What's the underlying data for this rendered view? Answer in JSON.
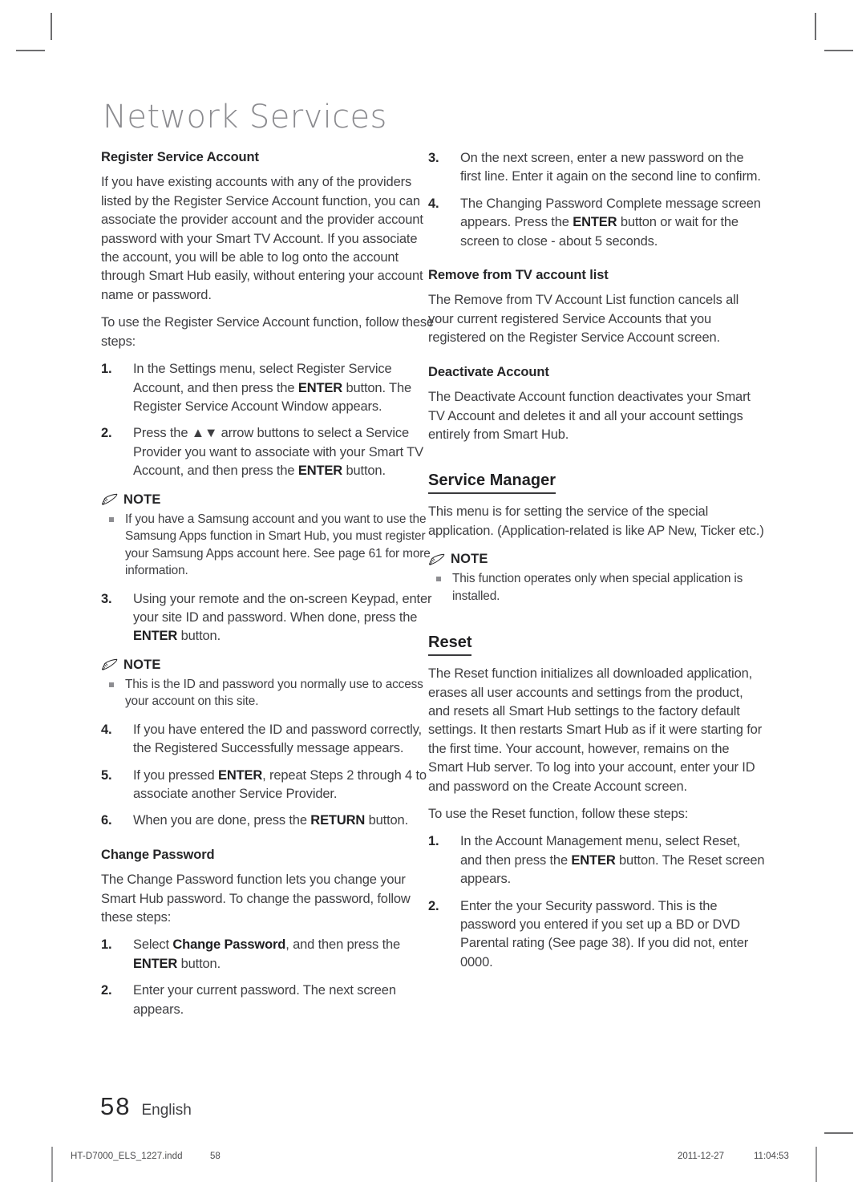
{
  "chapter": {
    "title": "Network Services"
  },
  "left_column": {
    "section1": {
      "heading": "Register Service Account",
      "paragraphs": [
        "If you have existing accounts with any of the providers listed by the Register Service Account function, you can associate the provider account and the provider account password with your Smart TV Account. If you associate the account, you will be able to log onto the account through Smart Hub easily, without entering your account name or password.",
        "To use the Register Service Account function, follow these steps:"
      ],
      "steps_a": [
        {
          "num": "1.",
          "parts": [
            {
              "t": "In the Settings menu, select Register Service Account, and then press the ",
              "b": false
            },
            {
              "t": "ENTER",
              "b": true
            },
            {
              "t": " button. The Register Service Account Window appears.",
              "b": false
            }
          ]
        },
        {
          "num": "2.",
          "parts": [
            {
              "t": "Press the ▲▼ arrow buttons to select a Service Provider you want to associate with your Smart TV Account, and then press the ",
              "b": false
            },
            {
              "t": "ENTER",
              "b": true
            },
            {
              "t": " button.",
              "b": false
            }
          ]
        }
      ],
      "note1": {
        "label": "NOTE",
        "items": [
          "If you have a Samsung account and you want to use the Samsung Apps function in Smart Hub, you must register your Samsung Apps account here. See page 61 for more information."
        ]
      },
      "steps_b": [
        {
          "num": "3.",
          "parts": [
            {
              "t": "Using your remote and the on-screen Keypad, enter your site ID and password. When done, press the ",
              "b": false
            },
            {
              "t": "ENTER",
              "b": true
            },
            {
              "t": " button.",
              "b": false
            }
          ]
        }
      ],
      "note2": {
        "label": "NOTE",
        "items": [
          "This is the ID and password you normally use to access your account on this site."
        ]
      },
      "steps_c": [
        {
          "num": "4.",
          "parts": [
            {
              "t": "If you have entered the ID and password correctly, the Registered Successfully message appears.",
              "b": false
            }
          ]
        },
        {
          "num": "5.",
          "parts": [
            {
              "t": "If you pressed ",
              "b": false
            },
            {
              "t": "ENTER",
              "b": true
            },
            {
              "t": ", repeat Steps 2 through 4 to associate another Service Provider.",
              "b": false
            }
          ]
        },
        {
          "num": "6.",
          "parts": [
            {
              "t": "When you are done, press the ",
              "b": false
            },
            {
              "t": "RETURN",
              "b": true
            },
            {
              "t": " button.",
              "b": false
            }
          ]
        }
      ]
    },
    "section2": {
      "heading": "Change Password",
      "paragraphs": [
        "The Change Password function lets you change your Smart Hub password. To change the password, follow these steps:"
      ],
      "steps": [
        {
          "num": "1.",
          "parts": [
            {
              "t": "Select ",
              "b": false
            },
            {
              "t": "Change Password",
              "b": true
            },
            {
              "t": ", and then press the ",
              "b": false
            },
            {
              "t": "ENTER",
              "b": true
            },
            {
              "t": " button.",
              "b": false
            }
          ]
        },
        {
          "num": "2.",
          "parts": [
            {
              "t": "Enter your current password. The next screen appears.",
              "b": false
            }
          ]
        }
      ]
    }
  },
  "right_column": {
    "steps_cont": [
      {
        "num": "3.",
        "parts": [
          {
            "t": "On the next screen, enter a new password on the first line. Enter it again on the second line to confirm.",
            "b": false
          }
        ]
      },
      {
        "num": "4.",
        "parts": [
          {
            "t": "The Changing Password Complete message screen appears. Press the ",
            "b": false
          },
          {
            "t": "ENTER",
            "b": true
          },
          {
            "t": " button or wait for the screen to close - about 5 seconds.",
            "b": false
          }
        ]
      }
    ],
    "section_remove": {
      "heading": "Remove from TV account list",
      "paragraphs": [
        "The Remove from TV Account List function cancels all your current registered Service Accounts that you registered on the Register Service Account screen."
      ]
    },
    "section_deactivate": {
      "heading": "Deactivate Account",
      "paragraphs": [
        "The Deactivate Account function deactivates your Smart TV Account and deletes it and all your account settings entirely from Smart Hub."
      ]
    },
    "section_service_manager": {
      "heading": "Service Manager",
      "paragraphs": [
        "This menu is for setting the service of the special application. (Application-related is like AP New, Ticker etc.)"
      ],
      "note": {
        "label": "NOTE",
        "items": [
          "This function operates only when special application is installed."
        ]
      }
    },
    "section_reset": {
      "heading": "Reset",
      "paragraphs": [
        "The Reset function initializes all downloaded application, erases all user accounts and settings from the product, and resets all Smart Hub settings to the factory default settings. It then restarts Smart Hub as if it were starting for the first time. Your account, however, remains on the Smart Hub server. To log into your account, enter your ID and password on the Create Account screen.",
        "To use the Reset function, follow these steps:"
      ],
      "steps": [
        {
          "num": "1.",
          "parts": [
            {
              "t": "In the Account Management menu, select Reset, and then press the ",
              "b": false
            },
            {
              "t": "ENTER",
              "b": true
            },
            {
              "t": " button. The Reset screen appears.",
              "b": false
            }
          ]
        },
        {
          "num": "2.",
          "parts": [
            {
              "t": "Enter the your Security password. This is the password you entered if you set up a BD or DVD Parental rating (See page 38). If you did not, enter 0000.",
              "b": false
            }
          ]
        }
      ]
    }
  },
  "page_footer": {
    "page_number": "58",
    "language": "English",
    "file_name": "HT-D7000_ELS_1227.indd",
    "file_page": "58",
    "date": "2011-12-27",
    "time": "11:04:53"
  },
  "colors": {
    "body_text": "#3f3f42",
    "heading_text": "#262628",
    "chapter_title": "#8b8b8f",
    "bullet": "#8d8d91",
    "crop_mark": "#6e6e70"
  }
}
